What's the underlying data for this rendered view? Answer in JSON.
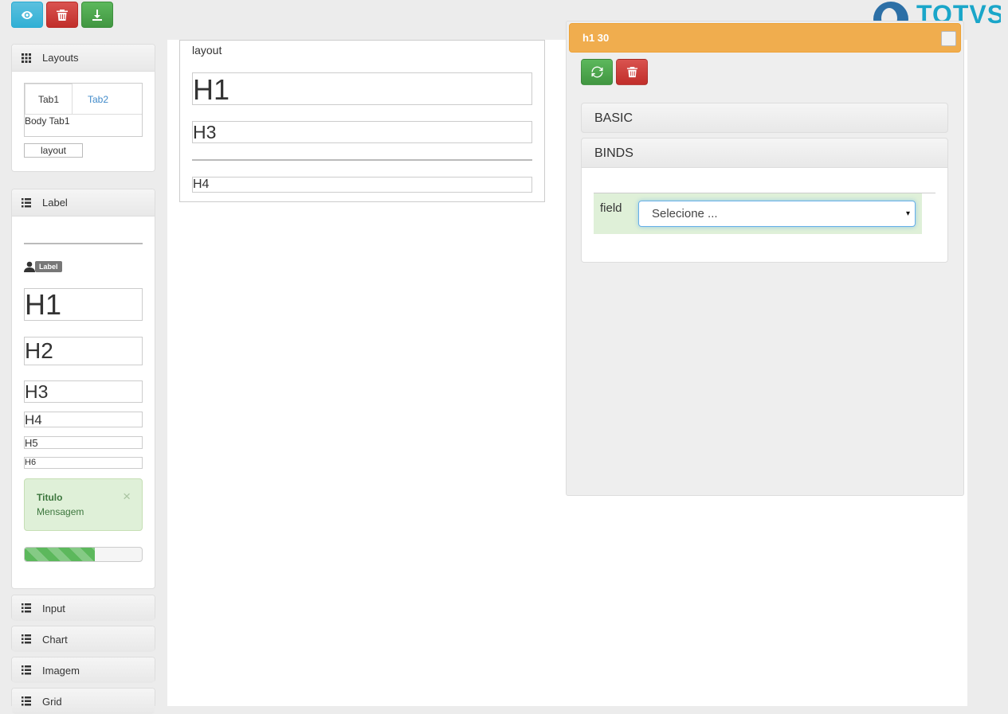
{
  "toolbar": {
    "preview_icon": "eye-icon",
    "delete_icon": "trash-icon",
    "download_icon": "download-icon"
  },
  "logo": {
    "text": "TOTVS"
  },
  "sidebar": {
    "layouts": {
      "title": "Layouts",
      "icon": "grid-icon",
      "tabs": [
        "Tab1",
        "Tab2"
      ],
      "tab_body": "Body Tab1",
      "layout_chip": "layout"
    },
    "label": {
      "title": "Label",
      "icon": "list-icon",
      "badge": "Label",
      "headings": [
        "H1",
        "H2",
        "H3",
        "H4",
        "H5",
        "H6"
      ],
      "alert_title": "Titulo",
      "alert_message": "Mensagem",
      "alert_close": "×",
      "progress": 0.6
    },
    "sections": [
      "Input",
      "Chart",
      "Imagem",
      "Grid"
    ]
  },
  "layout": {
    "title": "layout",
    "h1": "H1",
    "h3": "H3",
    "h4": "H4"
  },
  "properties": {
    "header": "h1 30",
    "accordion": [
      "BASIC",
      "BINDS"
    ],
    "field_label": "field",
    "select_value": "Selecione ...",
    "select_caret": "▾"
  },
  "colors": {
    "warning": "#f0ad4e",
    "success": "#5cb85c",
    "danger": "#d9534f",
    "info": "#5bc0de"
  }
}
